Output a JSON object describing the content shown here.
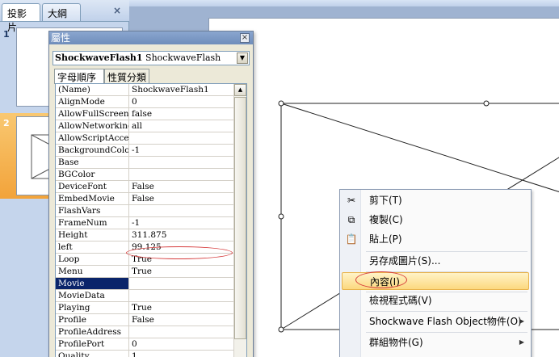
{
  "slides_pane": {
    "tabs": [
      "投影片",
      "大綱"
    ],
    "close_glyph": "×",
    "slide_numbers": [
      "1",
      "2"
    ]
  },
  "properties": {
    "title": "屬性",
    "close_glyph": "×",
    "object_name": "ShockwaveFlash1",
    "object_type": "ShockwaveFlash",
    "tabs": [
      "字母順序",
      "性質分類"
    ],
    "rows": [
      {
        "k": "(Name)",
        "v": "ShockwaveFlash1"
      },
      {
        "k": "AlignMode",
        "v": "0"
      },
      {
        "k": "AllowFullScreen",
        "v": "false"
      },
      {
        "k": "AllowNetworking",
        "v": "all"
      },
      {
        "k": "AllowScriptAccess",
        "v": ""
      },
      {
        "k": "BackgroundColor",
        "v": "-1"
      },
      {
        "k": "Base",
        "v": ""
      },
      {
        "k": "BGColor",
        "v": ""
      },
      {
        "k": "DeviceFont",
        "v": "False"
      },
      {
        "k": "EmbedMovie",
        "v": "False"
      },
      {
        "k": "FlashVars",
        "v": ""
      },
      {
        "k": "FrameNum",
        "v": "-1"
      },
      {
        "k": "Height",
        "v": "311.875"
      },
      {
        "k": "left",
        "v": "99.125"
      },
      {
        "k": "Loop",
        "v": "True"
      },
      {
        "k": "Menu",
        "v": "True"
      },
      {
        "k": "Movie",
        "v": ""
      },
      {
        "k": "MovieData",
        "v": ""
      },
      {
        "k": "Playing",
        "v": "True"
      },
      {
        "k": "Profile",
        "v": "False"
      },
      {
        "k": "ProfileAddress",
        "v": ""
      },
      {
        "k": "ProfilePort",
        "v": "0"
      },
      {
        "k": "Quality",
        "v": "1"
      }
    ]
  },
  "context_menu": {
    "items": [
      {
        "label": "剪下(T)",
        "icon": "scissors-icon"
      },
      {
        "label": "複製(C)",
        "icon": "copy-icon"
      },
      {
        "label": "貼上(P)",
        "icon": "paste-icon"
      },
      {
        "label": "另存成圖片(S)..."
      },
      {
        "label": "內容(I)"
      },
      {
        "label": "檢視程式碼(V)"
      },
      {
        "label": "Shockwave Flash Object物件(O)"
      },
      {
        "label": "群組物件(G)"
      }
    ]
  },
  "colors": {
    "selection": "#0a246a",
    "highlight": "#fcd87f",
    "annotation": "#d63b3b"
  }
}
